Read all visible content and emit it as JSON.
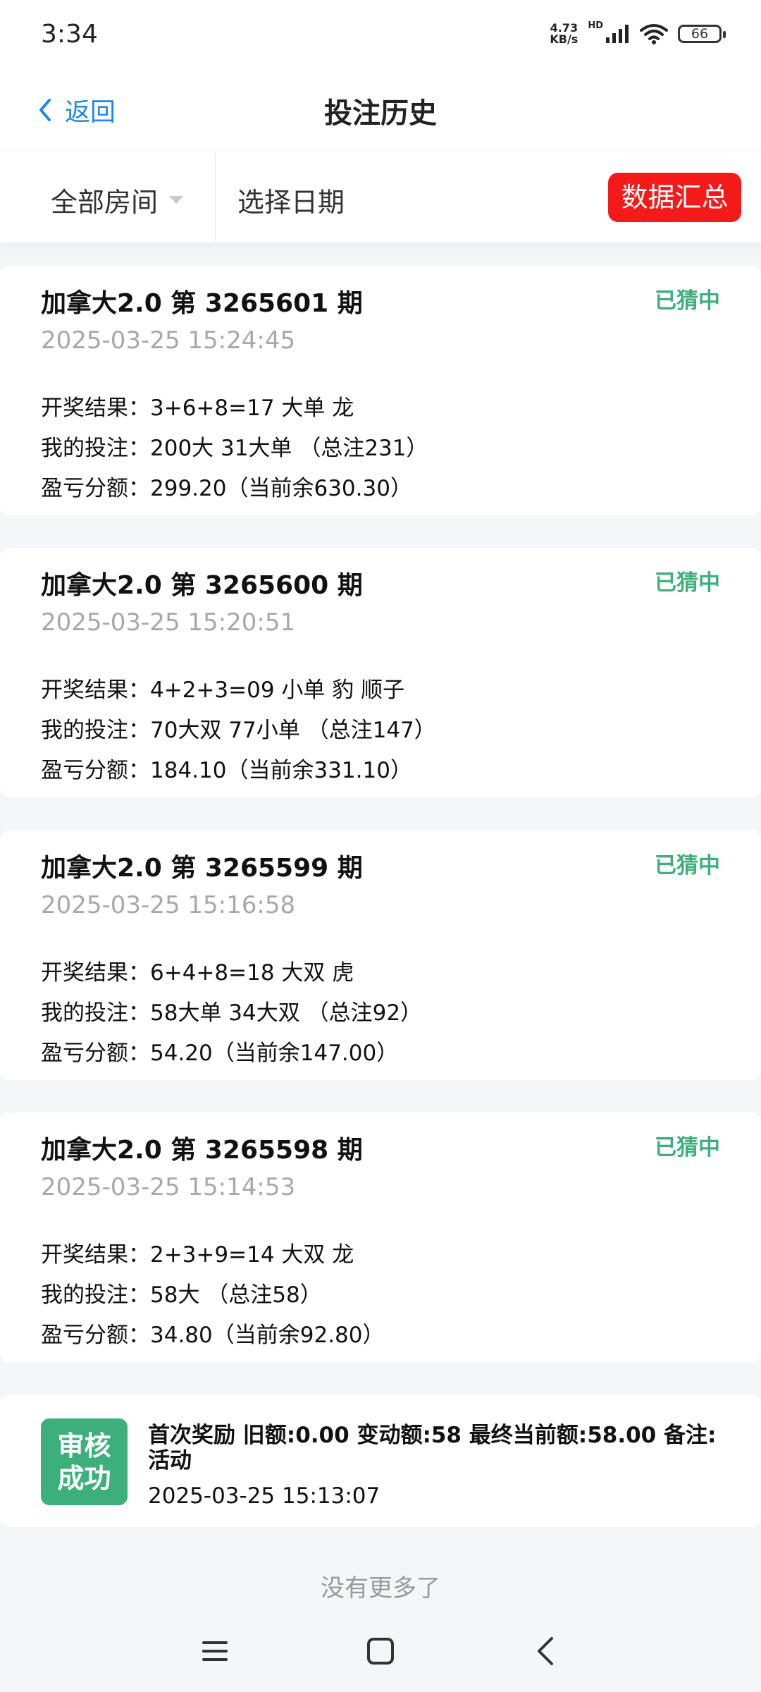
{
  "status_bar": {
    "time": "3:34",
    "net_speed_value": "4.73",
    "net_speed_unit": "KB/s",
    "hd_label": "HD",
    "battery": "66"
  },
  "nav": {
    "back_label": "返回",
    "title": "投注历史"
  },
  "filters": {
    "room_label": "全部房间",
    "date_label": "选择日期",
    "summary_button": "数据汇总"
  },
  "bets": [
    {
      "title": "加拿大2.0 第 3265601 期",
      "status": "已猜中",
      "time": "2025-03-25 15:24:45",
      "result": "开奖结果：3+6+8=17 大单 龙",
      "bet": "我的投注：200大 31大单 （总注231）",
      "profit": "盈亏分额：299.20（当前余630.30）"
    },
    {
      "title": "加拿大2.0 第 3265600 期",
      "status": "已猜中",
      "time": "2025-03-25 15:20:51",
      "result": "开奖结果：4+2+3=09 小单 豹 顺子",
      "bet": "我的投注：70大双 77小单 （总注147）",
      "profit": "盈亏分额：184.10（当前余331.10）"
    },
    {
      "title": "加拿大2.0 第 3265599 期",
      "status": "已猜中",
      "time": "2025-03-25 15:16:58",
      "result": "开奖结果：6+4+8=18 大双 虎",
      "bet": "我的投注：58大单 34大双 （总注92）",
      "profit": "盈亏分额：54.20（当前余147.00）"
    },
    {
      "title": "加拿大2.0 第 3265598 期",
      "status": "已猜中",
      "time": "2025-03-25 15:14:53",
      "result": "开奖结果：2+3+9=14 大双 龙",
      "bet": "我的投注：58大 （总注58）",
      "profit": "盈亏分额：34.80（当前余92.80）"
    }
  ],
  "activity": {
    "badge_line1": "审核",
    "badge_line2": "成功",
    "text": "首次奖励 旧额:0.00 变动额:58 最终当前额:58.00 备注:活动",
    "time": "2025-03-25 15:13:07"
  },
  "footer": {
    "no_more": "没有更多了"
  },
  "colors": {
    "accent_blue": "#1e88e5",
    "success_green": "#3daf7d",
    "summary_red": "#f51a1a"
  },
  "icons": {
    "back": "chevron-left-icon",
    "menu": "menu-icon",
    "home": "home-square-icon",
    "sys_back": "back-chevron-icon"
  }
}
